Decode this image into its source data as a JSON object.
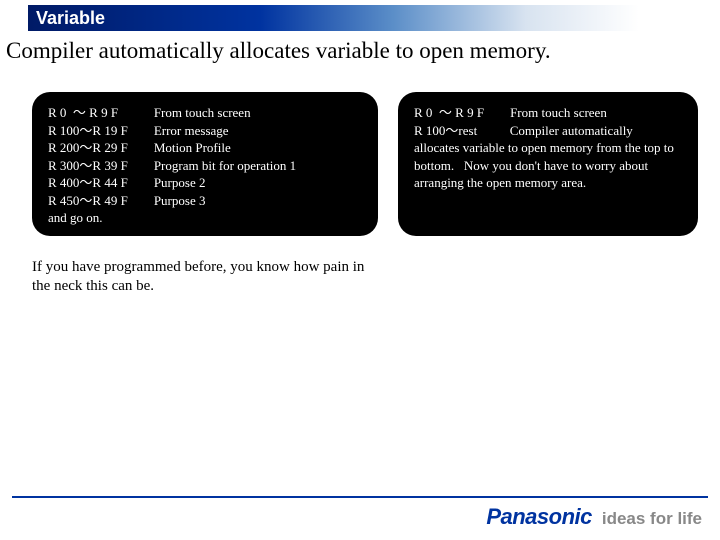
{
  "header": {
    "title": "Variable"
  },
  "subtitle": "Compiler automatically allocates variable to open memory.",
  "left_panel": {
    "rows": [
      {
        "range": "R 0  ～ R 9 F",
        "desc": "From touch screen"
      },
      {
        "range": "R 100～R 19 F",
        "desc": "Error message"
      },
      {
        "range": "R 200～R 29 F",
        "desc": "Motion Profile"
      },
      {
        "range": "R 300～R 39 F",
        "desc": "Program bit for operation 1"
      },
      {
        "range": "R 400～R 44 F",
        "desc": "Purpose 2"
      },
      {
        "range": "R 450～R 49 F",
        "desc": "Purpose 3"
      }
    ],
    "tail": "and go on."
  },
  "right_panel": {
    "line1_range": "R 0  ～ R 9 F",
    "line1_desc": "From touch screen",
    "line2_range": "R 100～rest",
    "line2_desc": "Compiler automatically",
    "body": "allocates variable to open memory from the top to bottom.   Now you don't have to worry about arranging the open memory area."
  },
  "bottom_text": "If you have programmed before, you know how pain in the neck this can be.",
  "footer": {
    "brand": "Panasonic",
    "tagline": "ideas for life"
  }
}
